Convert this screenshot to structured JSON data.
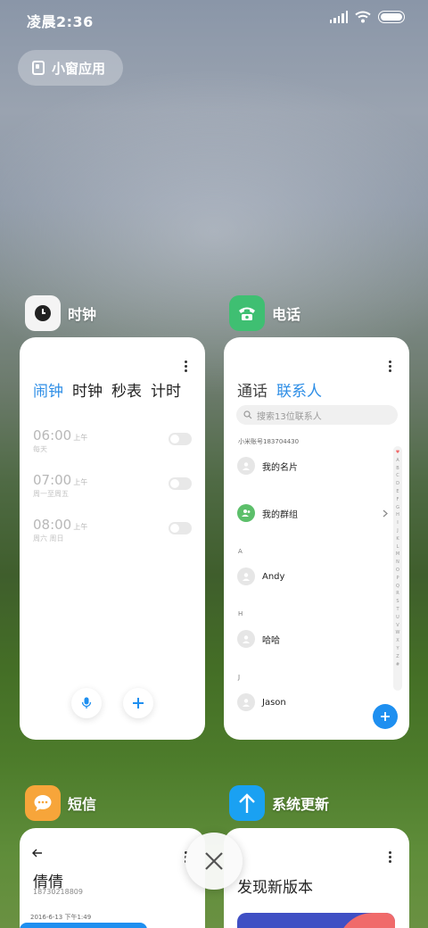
{
  "status_bar": {
    "time": "凌晨2:36",
    "battery_level": 1.0
  },
  "float_window": {
    "label": "小窗应用"
  },
  "cards": {
    "clock": {
      "app_name": "时钟",
      "tabs": [
        "闹钟",
        "时钟",
        "秒表",
        "计时"
      ],
      "active_tab": 0,
      "alarms": [
        {
          "time": "06:00",
          "ampm": "上午",
          "repeat": "每天"
        },
        {
          "time": "07:00",
          "ampm": "上午",
          "repeat": "周一至周五"
        },
        {
          "time": "08:00",
          "ampm": "上午",
          "repeat": "周六 周日"
        }
      ]
    },
    "phone": {
      "app_name": "电话",
      "tabs": [
        "通话",
        "联系人"
      ],
      "active_tab": 1,
      "search_placeholder": "搜索13位联系人",
      "account": "小米账号183704430",
      "my_card": "我的名片",
      "my_group": "我的群组",
      "sections": [
        {
          "letter": "A",
          "contact": "Andy"
        },
        {
          "letter": "H",
          "contact": "哈哈"
        },
        {
          "letter": "J",
          "contact": "Jason"
        }
      ],
      "index_letters": [
        "♥",
        "A",
        "B",
        "C",
        "D",
        "E",
        "F",
        "G",
        "H",
        "I",
        "J",
        "K",
        "L",
        "M",
        "N",
        "O",
        "P",
        "Q",
        "R",
        "S",
        "T",
        "U",
        "V",
        "W",
        "X",
        "Y",
        "Z",
        "#"
      ]
    },
    "sms": {
      "app_name": "短信",
      "contact_name": "倩倩",
      "contact_number": "18730218809",
      "timestamp": "2016-6-13 下午1:49"
    },
    "update": {
      "app_name": "系统更新",
      "title": "发现新版本"
    }
  },
  "colors": {
    "accent": "#2e8ee6",
    "phone_icon": "#3fbf72",
    "sms_icon": "#f7a53a",
    "update_icon": "#1aa1f2"
  }
}
